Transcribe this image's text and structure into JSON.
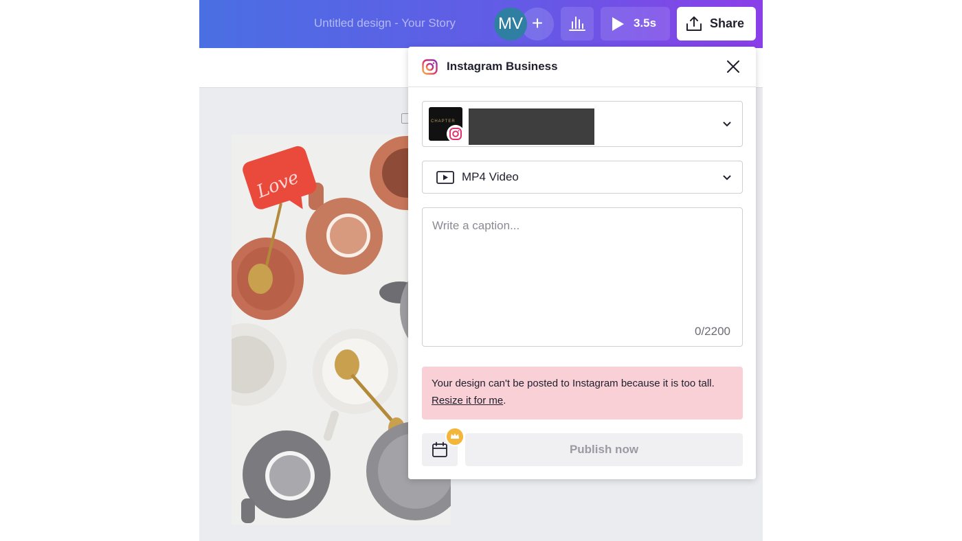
{
  "header": {
    "doc_title": "Untitled design - Your Story",
    "avatar_initials": "MV",
    "add_symbol": "+",
    "analytics_icon": "bar-chart-icon",
    "play_icon": "play-icon",
    "duration": "3.5s",
    "share_icon": "upload-icon",
    "share_label": "Share"
  },
  "panel": {
    "title": "Instagram Business",
    "platform_icon": "instagram-icon",
    "close_icon": "close-icon",
    "account": {
      "thumb_text": "CHAPTER",
      "name_redacted": true
    },
    "format": {
      "icon": "video-icon",
      "label": "MP4 Video"
    },
    "caption": {
      "placeholder": "Write a caption...",
      "value": "",
      "counter": "0/2200"
    },
    "warning": {
      "message": "Your design can't be posted to Instagram because it is too tall.",
      "link_label": "Resize it for me",
      "trailing": "."
    },
    "schedule_icon": "calendar-icon",
    "pro_badge_icon": "crown-icon",
    "publish_label": "Publish now"
  },
  "canvas": {
    "sticker_text": "Love"
  },
  "colors": {
    "topbar_start": "#4a6fe3",
    "topbar_end": "#8b3fe8",
    "warning_bg": "#f8d0d6",
    "sticker": "#ea4a3c",
    "avatar": "#2f7fa3"
  }
}
